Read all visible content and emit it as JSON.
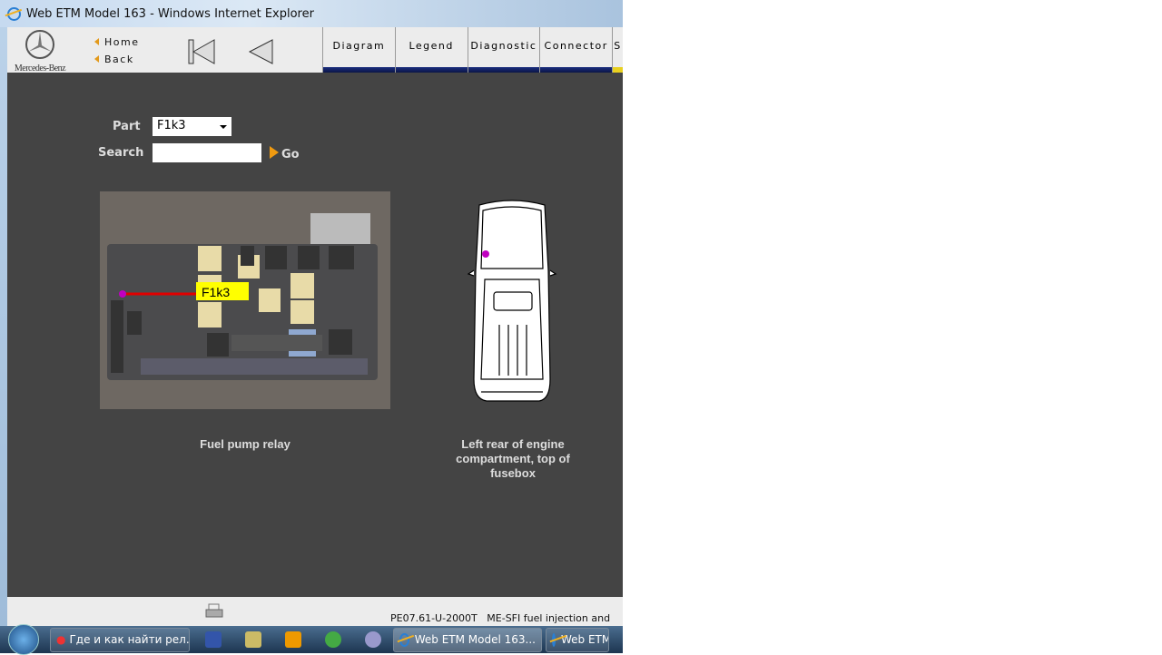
{
  "window": {
    "title": "Web ETM Model 163 - Windows Internet Explorer"
  },
  "header": {
    "brand": "Mercedes-Benz",
    "home": "Home",
    "back": "Back",
    "tabs": [
      "Diagram",
      "Legend",
      "Diagnostic",
      "Connector",
      "S"
    ]
  },
  "form": {
    "part_label": "Part",
    "part_value": "F1k3",
    "search_label": "Search",
    "search_value": "",
    "go": "Go"
  },
  "photo": {
    "callout": "F1k3",
    "caption": "Fuel pump relay"
  },
  "location": {
    "caption": "Left rear of engine compartment, top of fusebox"
  },
  "footer": {
    "code": "PE07.61-U-2000T",
    "description": "ME-SFI fuel injection and"
  },
  "taskbar": {
    "items": [
      "Где и как найти рел...",
      "Web ETM Model 163...",
      "Web ETM"
    ]
  },
  "colors": {
    "marker": "#c000c0",
    "pointer": "#e00000",
    "callout_bg": "#ffff00",
    "accent": "#f09a10"
  }
}
